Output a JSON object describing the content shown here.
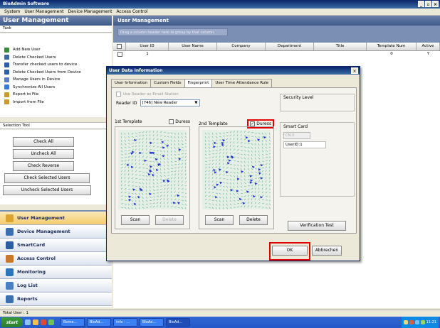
{
  "window": {
    "title": "BioAdmin Software",
    "controls": [
      "_",
      "▫",
      "×"
    ]
  },
  "menu": [
    "System",
    "User Management",
    "Device Management",
    "Access Control"
  ],
  "left_panel": {
    "header": "User Management",
    "task_label": "Task",
    "tasks": [
      {
        "label": "Add New User",
        "icon": "add-user-icon",
        "color": "#3c8a3c"
      },
      {
        "label": "Delete Checked Users",
        "icon": "delete-users-icon",
        "color": "#3c6aa5"
      },
      {
        "label": "Transfer checked users to device",
        "icon": "transfer-icon",
        "color": "#2c5fa8"
      },
      {
        "label": "Delete Checked Users from Device",
        "icon": "delete-device-icon",
        "color": "#2c5fa8"
      },
      {
        "label": "Manage Users in Device",
        "icon": "manage-icon",
        "color": "#5a7ec0"
      },
      {
        "label": "Synchronize All Users",
        "icon": "sync-icon",
        "color": "#3b7bd1"
      },
      {
        "label": "Export to File",
        "icon": "export-icon",
        "color": "#c99a2e"
      },
      {
        "label": "Import from File",
        "icon": "import-icon",
        "color": "#c99a2e"
      }
    ],
    "selection_label": "Selection Tool",
    "selection_buttons": [
      "Check All",
      "Uncheck All",
      "Check Reverse",
      "Check Selected Users",
      "Uncheck Selected Users"
    ],
    "nav": [
      {
        "label": "User Management",
        "icon": "user-management-icon",
        "color": "#d9a530",
        "active": true
      },
      {
        "label": "Device Management",
        "icon": "device-management-icon",
        "color": "#3b6fb0"
      },
      {
        "label": "SmartCard",
        "icon": "smartcard-icon",
        "color": "#2d5fa0"
      },
      {
        "label": "Access Control",
        "icon": "access-control-icon",
        "color": "#c77a2a"
      },
      {
        "label": "Monitoring",
        "icon": "monitoring-icon",
        "color": "#2d74b8"
      },
      {
        "label": "Log List",
        "icon": "log-list-icon",
        "color": "#4a7fc4"
      },
      {
        "label": "Reports",
        "icon": "reports-icon",
        "color": "#3b6fb0"
      }
    ]
  },
  "right_panel": {
    "header": "User Management",
    "group_hint": "Drag a column header here to group by that column.",
    "columns": [
      "",
      "User ID",
      "User Name",
      "Company",
      "Department",
      "Title",
      "Template Num",
      "Active"
    ],
    "row": [
      "",
      "1",
      "",
      "",
      "",
      "",
      "0",
      "Y"
    ]
  },
  "dialog": {
    "title": "User Data Information",
    "close": "×",
    "tabs": [
      "User Information",
      "Custom Fields",
      "Fingerprint",
      "User Time Attendance Rule"
    ],
    "active_tab": 2,
    "email_station_label": "Use Reader as Email Station",
    "reader_label": "Reader ID",
    "reader_value": "[746] New Reader",
    "template1": {
      "label": "1st Template",
      "duress_label": "Duress",
      "duress_checked": false
    },
    "template2": {
      "label": "2nd Template",
      "duress_label": "Duress",
      "duress_checked": true
    },
    "scan_label": "Scan",
    "delete_label": "Delete",
    "security_level_label": "Security Level",
    "smart_card_label": "Smart Card",
    "card_value": "CN:3",
    "userid_value": "UserID:1",
    "verification_label": "Verification Test",
    "ok_label": "OK",
    "cancel_label": "Abbrechen"
  },
  "status": {
    "total_user": "Total User : 1"
  },
  "taskbar": {
    "start": "start",
    "tasks": [
      "Bome...",
      "BioAd...",
      "info - ...",
      "BioAd...",
      "BioAd..."
    ],
    "active_task": 4,
    "time": "11:21"
  }
}
